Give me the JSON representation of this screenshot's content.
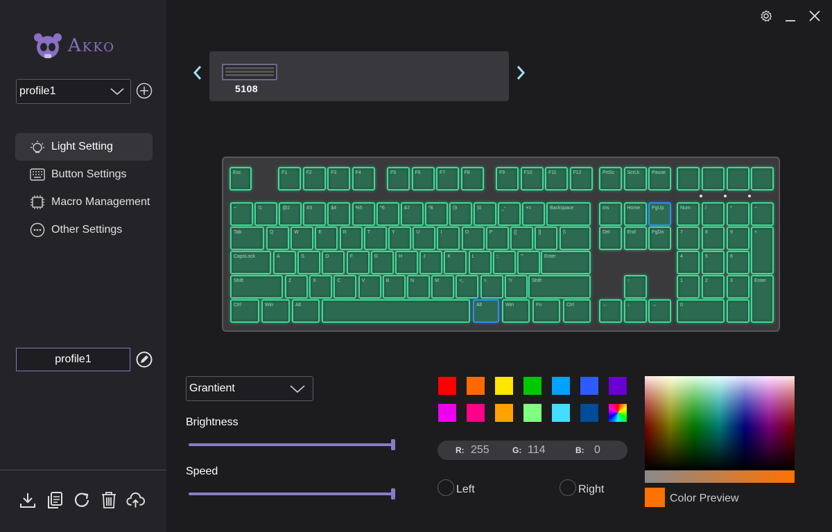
{
  "brand": {
    "name": "Akko"
  },
  "sidebar": {
    "profile_select": "profile1",
    "menu": [
      {
        "label": "Light Setting",
        "icon": "light-bulb-icon",
        "active": true
      },
      {
        "label": "Button Settings",
        "icon": "keyboard-icon",
        "active": false
      },
      {
        "label": "Macro Management",
        "icon": "chip-icon",
        "active": false
      },
      {
        "label": "Other Settings",
        "icon": "dots-circle-icon",
        "active": false
      }
    ],
    "profile_name": "profile1",
    "bottom_tools": [
      "import-icon",
      "copy-icon",
      "reset-icon",
      "delete-icon",
      "upload-icon"
    ]
  },
  "device": {
    "name": "5108"
  },
  "keyboard": {
    "row_f": [
      "Esc",
      "F1",
      "F2",
      "F3",
      "F4",
      "F5",
      "F6",
      "F7",
      "F8",
      "F9",
      "F10",
      "F11",
      "F12",
      "PrtSc",
      "ScrLk",
      "Pause"
    ],
    "row_num": [
      "~`",
      "!1",
      "@2",
      "#3",
      "$4",
      "%5",
      "^6",
      "&7",
      "*8",
      "(9",
      ")0",
      "_-",
      "+=",
      "Backspace"
    ],
    "row_tab": [
      "Tab",
      "Q",
      "W",
      "E",
      "R",
      "T",
      "Y",
      "U",
      "I",
      "O",
      "P",
      "{[",
      "}]",
      "|\\"
    ],
    "row_caps": [
      "CapsLock",
      "A",
      "S",
      "D",
      "F",
      "G",
      "H",
      "J",
      "K",
      "L",
      ":;",
      "\"'",
      "Enter"
    ],
    "row_shift": [
      "Shift",
      "Z",
      "X",
      "C",
      "V",
      "B",
      "N",
      "M",
      "<,",
      ">.",
      "?/",
      "Shift"
    ],
    "row_ctrl": [
      "Ctrl",
      "Win",
      "Alt",
      "",
      "Alt",
      "Win",
      "Fn",
      "Ctrl"
    ],
    "nav": [
      "Ins",
      "Home",
      "PgUp",
      "Del",
      "End",
      "PgDn"
    ],
    "arrows": [
      "↑",
      "←",
      "↓",
      "→"
    ],
    "numpad": [
      "Num",
      "/",
      "*",
      "−",
      "7",
      "8",
      "9",
      "+",
      "4",
      "5",
      "6",
      "1",
      "2",
      "3",
      "Enter",
      "0",
      "."
    ],
    "key_color": "#3ddc97",
    "highlight_color": "#2a8ff0"
  },
  "lighting": {
    "mode": "Grantient",
    "brightness_label": "Brightness",
    "brightness": 1.0,
    "speed_label": "Speed",
    "speed": 1.0,
    "swatches": [
      "#ff0000",
      "#ff6a00",
      "#ffe600",
      "#00c800",
      "#00a2ff",
      "#2d5bff",
      "#6a00d0",
      "#ee00ee",
      "#ff0088",
      "#ffa200",
      "#80ff80",
      "#44ddff",
      "#004c99",
      "rainbow"
    ],
    "r_label": "R:",
    "r": "255",
    "g_label": "G:",
    "g": "114",
    "b_label": "B:",
    "b": "0",
    "left_label": "Left",
    "right_label": "Right",
    "preview_label": "Color Preview",
    "preview_color": "#ff7200"
  }
}
